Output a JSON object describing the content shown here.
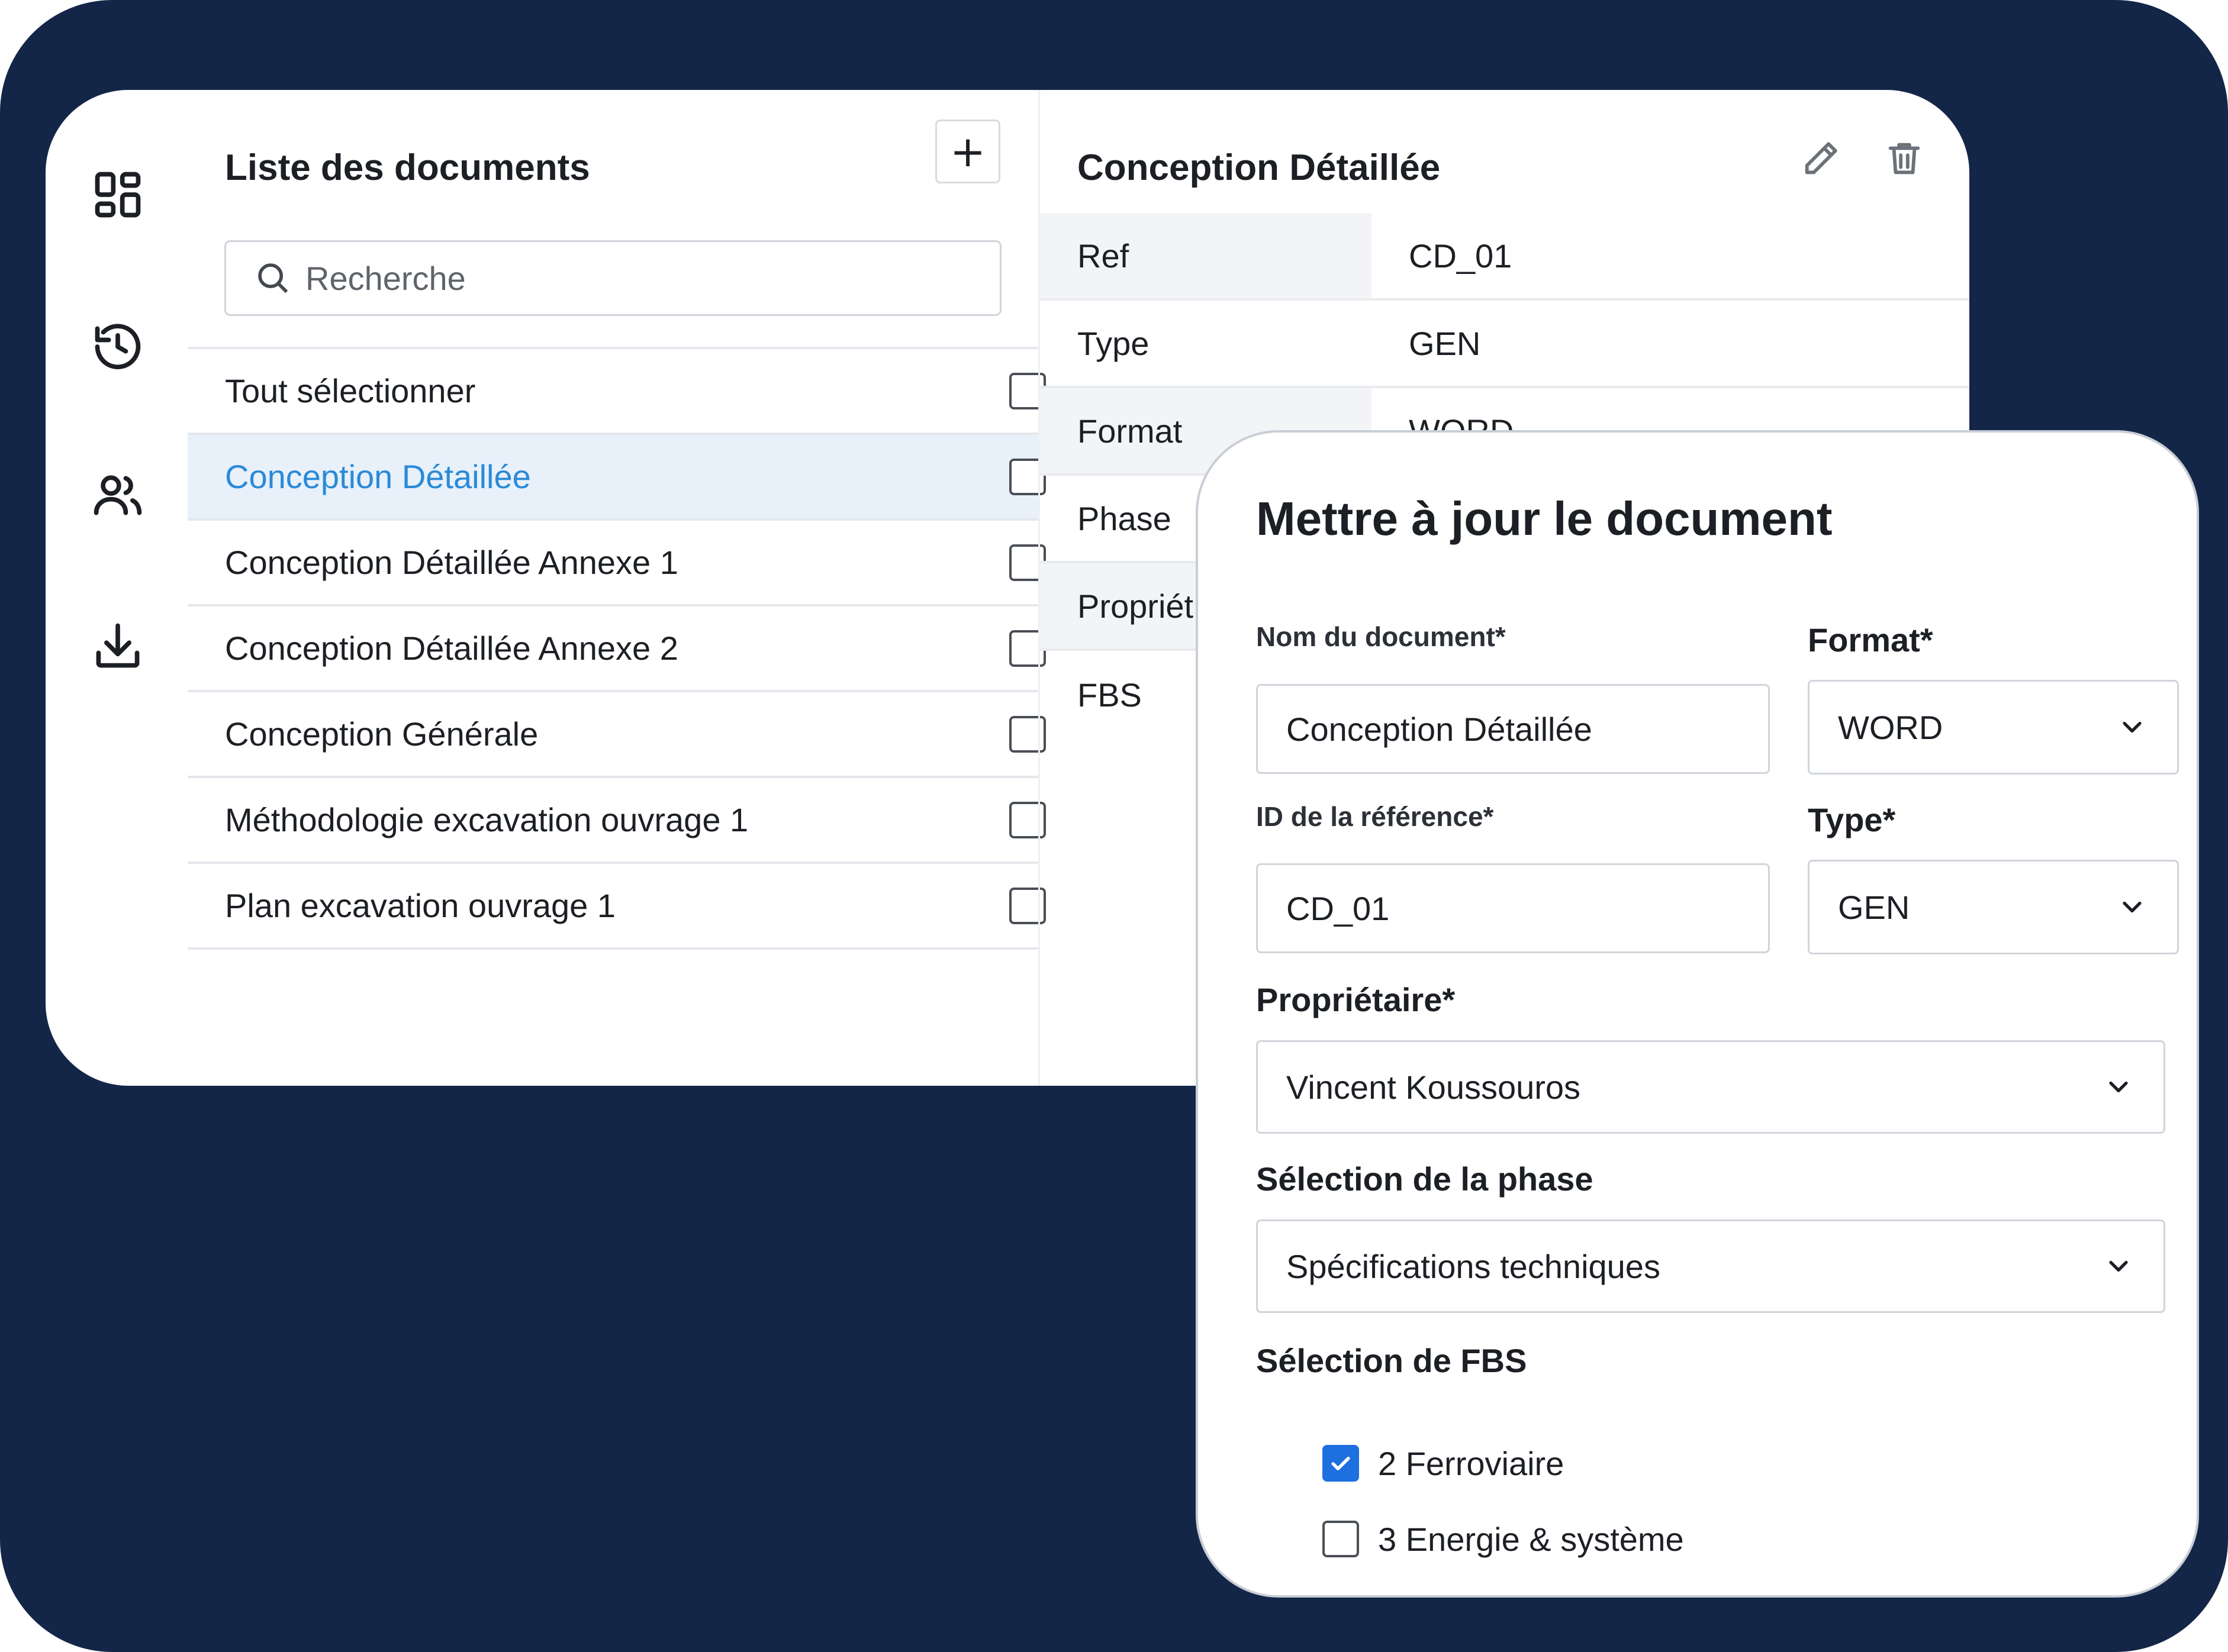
{
  "sidebar": {
    "icons": [
      "dashboard-icon",
      "history-icon",
      "users-icon",
      "download-icon"
    ]
  },
  "document_list": {
    "title": "Liste des documents",
    "add_label": "+",
    "search_placeholder": "Recherche",
    "select_all_label": "Tout sélectionner",
    "items": [
      {
        "label": "Conception Détaillée",
        "selected": true
      },
      {
        "label": "Conception Détaillée Annexe 1",
        "selected": false
      },
      {
        "label": "Conception Détaillée Annexe 2",
        "selected": false
      },
      {
        "label": "Conception Générale",
        "selected": false
      },
      {
        "label": "Méthodologie excavation ouvrage 1",
        "selected": false
      },
      {
        "label": "Plan excavation ouvrage 1",
        "selected": false
      }
    ]
  },
  "details": {
    "title": "Conception Détaillée",
    "properties": [
      {
        "key": "Ref",
        "value": "CD_01"
      },
      {
        "key": "Type",
        "value": "GEN"
      },
      {
        "key": "Format",
        "value": "WORD"
      },
      {
        "key": "Phase",
        "value": ""
      },
      {
        "key": "Propriét",
        "value": ""
      },
      {
        "key": "FBS",
        "value": ""
      }
    ]
  },
  "modal": {
    "title": "Mettre à jour le document",
    "name_label": "Nom du document*",
    "name_value": "Conception Détaillée",
    "format_label": "Format*",
    "format_value": "WORD",
    "ref_label": "ID de la référence*",
    "ref_value": "CD_01",
    "type_label": "Type*",
    "type_value": "GEN",
    "owner_label": "Propriétaire*",
    "owner_value": "Vincent Koussouros",
    "phase_label": "Sélection de la phase",
    "phase_value": "Spécifications techniques",
    "fbs_label": "Sélection de FBS",
    "fbs_options": [
      {
        "label": "2 Ferroviaire",
        "checked": true
      },
      {
        "label": "3 Energie & système",
        "checked": false
      }
    ]
  },
  "colors": {
    "background": "#132648",
    "accent": "#1e6fe0",
    "selected_text": "#2a8ad8",
    "selected_row": "#e8f0fa"
  }
}
